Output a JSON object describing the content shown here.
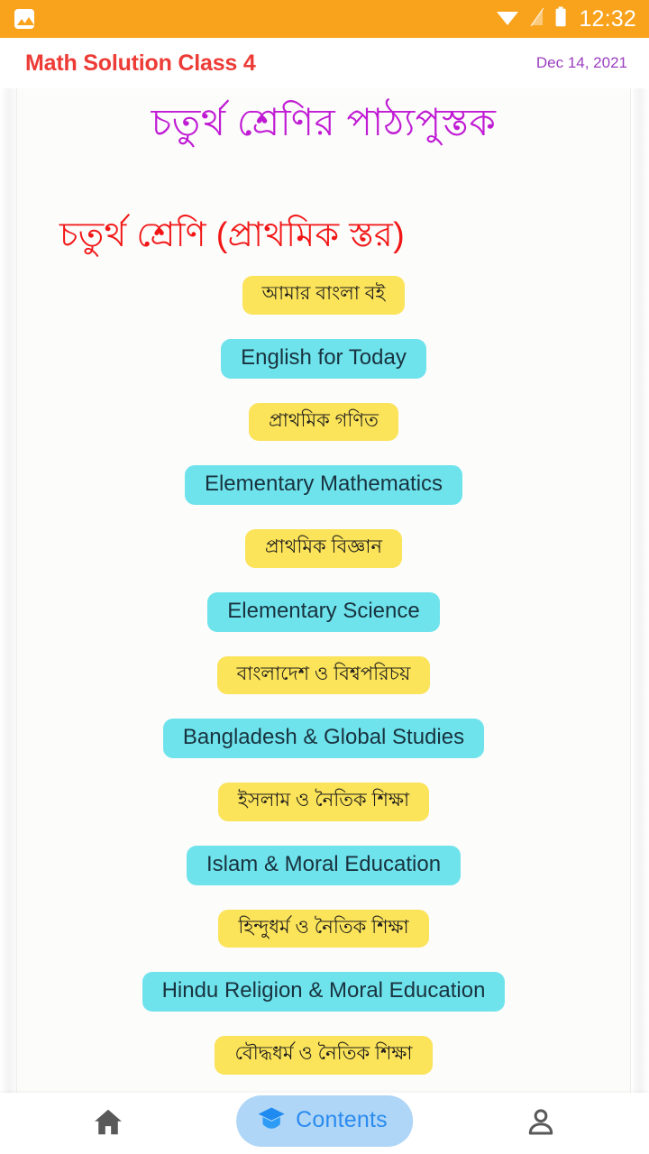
{
  "statusbar": {
    "time": "12:32",
    "icons": [
      "image-notification-icon",
      "wifi-icon",
      "cellular-signal-off-icon",
      "battery-icon"
    ],
    "background_color": "#F9A21B"
  },
  "appbar": {
    "title": "Math Solution Class 4",
    "title_color": "#ED3B36",
    "date": "Dec 14, 2021",
    "date_color": "#9B3FBF"
  },
  "document": {
    "title": "চতুর্থ শ্রেণির পাঠ্যপুস্তক",
    "title_color": "#C01BD4",
    "subtitle": "চতুর্থ শ্রেণি (প্রাথমিক স্তর)",
    "subtitle_color": "#F21616",
    "pill_colors": {
      "bengali": "#FBE35A",
      "english": "#6FE3EC"
    },
    "books": [
      {
        "label": "আমার বাংলা বই",
        "lang": "bn"
      },
      {
        "label": "English for Today",
        "lang": "en"
      },
      {
        "label": "প্রাথমিক গণিত",
        "lang": "bn"
      },
      {
        "label": "Elementary Mathematics",
        "lang": "en"
      },
      {
        "label": "প্রাথমিক বিজ্ঞান",
        "lang": "bn"
      },
      {
        "label": "Elementary Science",
        "lang": "en"
      },
      {
        "label": "বাংলাদেশ ও বিশ্বপরিচয়",
        "lang": "bn"
      },
      {
        "label": "Bangladesh & Global Studies",
        "lang": "en"
      },
      {
        "label": "ইসলাম ও নৈতিক শিক্ষা",
        "lang": "bn"
      },
      {
        "label": "Islam & Moral Education",
        "lang": "en"
      },
      {
        "label": "হিন্দুধর্ম ও নৈতিক শিক্ষা",
        "lang": "bn"
      },
      {
        "label": "Hindu Religion & Moral Education",
        "lang": "en"
      },
      {
        "label": "বৌদ্ধধর্ম ও নৈতিক শিক্ষা",
        "lang": "bn"
      }
    ]
  },
  "bottomnav": {
    "home_icon": "home-icon",
    "profile_icon": "person-icon",
    "contents_label": "Contents",
    "contents_icon": "graduation-cap-icon",
    "contents_bg": "#AFD6F7",
    "contents_text_color": "#2B8BEE"
  }
}
